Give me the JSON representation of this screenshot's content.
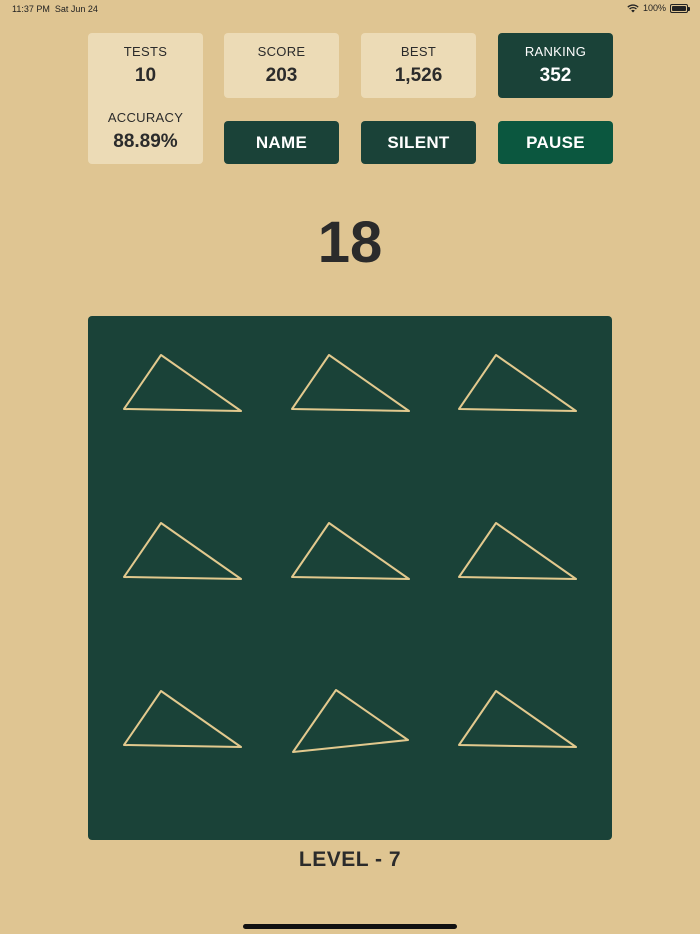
{
  "status_bar": {
    "time": "11:37 PM",
    "date": "Sat Jun 24",
    "battery": "100%"
  },
  "stats": {
    "tests": {
      "label": "TESTS",
      "value": "10"
    },
    "accuracy": {
      "label": "ACCURACY",
      "value": "88.89%"
    },
    "score": {
      "label": "SCORE",
      "value": "203"
    },
    "best": {
      "label": "BEST",
      "value": "1,526"
    },
    "ranking": {
      "label": "RANKING",
      "value": "352"
    }
  },
  "buttons": {
    "name": "NAME",
    "silent": "SILENT",
    "pause": "PAUSE"
  },
  "counter": "18",
  "level": "LEVEL - 7",
  "colors": {
    "background": "#dfc592",
    "tile": "#ecdbb6",
    "dark": "#1a4238",
    "active": "#0b573f",
    "shape_stroke": "#e2c98e"
  },
  "board": {
    "rows": 3,
    "cols": 3,
    "odd_cell": 7
  }
}
